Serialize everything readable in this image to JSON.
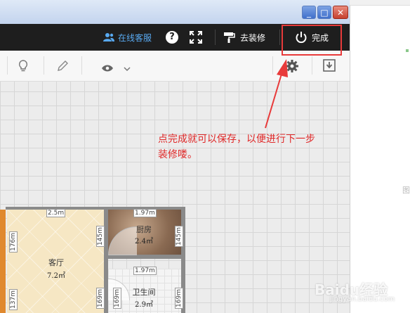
{
  "window": {
    "minimize_glyph": "_",
    "maximize_glyph": "□",
    "close_glyph": "✕"
  },
  "topbar": {
    "support_label": "在线客服",
    "help_label": "?",
    "decorate_label": "去装修",
    "done_label": "完成",
    "icons": [
      "support-person-icon",
      "help-icon",
      "fullscreen-icon",
      "paint-roller-icon",
      "power-icon"
    ]
  },
  "toolbar": {
    "icons": [
      "lightbulb-icon",
      "pencil-icon",
      "eye-icon",
      "chevron-down-icon",
      "gear-icon",
      "download-icon"
    ]
  },
  "annotation": {
    "text_line1": "点完成就可以保存，以便进行下一步",
    "text_line2": "装修喽。",
    "color": "#e02828"
  },
  "floorplan": {
    "living_room": {
      "name": "客厅",
      "area": "7.2㎡"
    },
    "kitchen": {
      "name": "厨房",
      "area": "2.4㎡"
    },
    "bathroom": {
      "name": "卫生间",
      "area": "2.9㎡"
    },
    "dims": {
      "top_living": "2.5m",
      "top_kitchen": "1.97m",
      "mid_bathroom": "1.97m",
      "left_upper": "176m",
      "left_lower": "137m",
      "living_right": "145m",
      "living_right_lower": "169m",
      "kitchen_right": "145m",
      "bath_left": "169m",
      "bath_right": "169m"
    }
  },
  "right_frame": {
    "char": "图"
  },
  "watermark": {
    "text": "Baidu经验",
    "sub": "jingyan.baidu.com"
  }
}
